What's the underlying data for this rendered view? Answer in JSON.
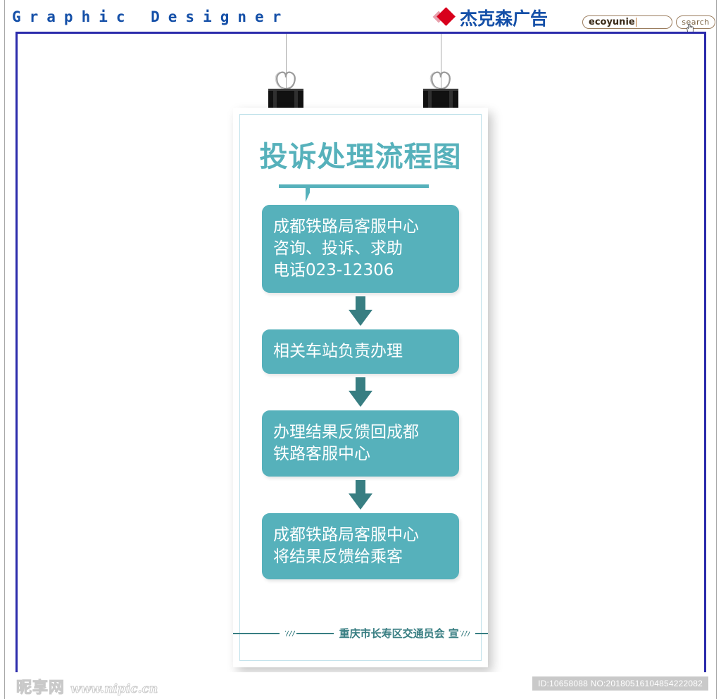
{
  "header": {
    "brand_title": "Graphic Designer",
    "logo_text": "杰克森广告",
    "logo_icon": "red-diamond-icon",
    "search": {
      "value": "ecoyunie",
      "placeholder": "",
      "button_label": "search",
      "cursor_icon": "hand-pointer-icon"
    }
  },
  "poster": {
    "title": "投诉处理流程图",
    "flow": [
      {
        "id": "step-1",
        "lines": [
          "成都铁路局客服中心",
          "咨询、投诉、求助",
          "电话023-12306"
        ]
      },
      {
        "id": "step-2",
        "lines": [
          "相关车站负责办理"
        ]
      },
      {
        "id": "step-3",
        "lines": [
          "办理结果反馈回成都",
          "铁路客服中心"
        ]
      },
      {
        "id": "step-4",
        "lines": [
          "成都铁路局客服中心",
          "将结果反馈给乘客"
        ]
      }
    ],
    "footer_text": "重庆市长寿区交通员会  宣"
  },
  "footer": {
    "watermark_cn": "昵享网",
    "watermark_url": "www.nipic.cn",
    "asset_id": "ID:10658088 NO:20180516104854222082"
  },
  "colors": {
    "brand_blue": "#1550a8",
    "frame_blue": "#2b2bab",
    "teal": "#56b1bb",
    "teal_dark": "#387e82",
    "logo_red": "#d8001c"
  }
}
